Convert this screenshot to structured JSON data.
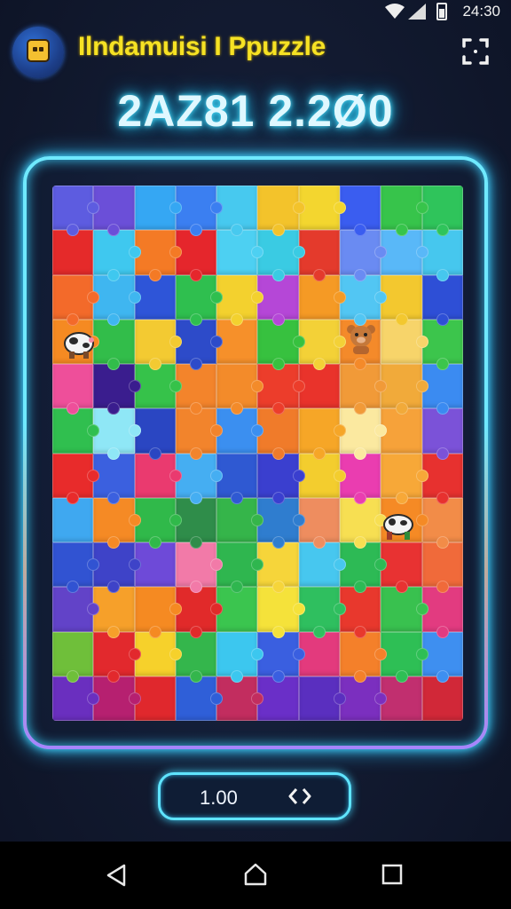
{
  "status_bar": {
    "time": "24:30",
    "icons": [
      "wifi-icon",
      "signal-icon",
      "battery-icon"
    ]
  },
  "header": {
    "title": "Ilndamuisi I Ppuzzle",
    "menu_icon": "fullscreen-corners-icon"
  },
  "score": {
    "text": "2AZ81 2.2Ø0"
  },
  "board": {
    "columns": 10,
    "rows": 12,
    "colors": [
      "#5d5ce0",
      "#6b4fd8",
      "#35a7f3",
      "#3b7ff1",
      "#47c9ef",
      "#f3c32b",
      "#f3d62f",
      "#3a5df0",
      "#37c44b",
      "#2fc45b",
      "#e52a2a",
      "#3fc8ef",
      "#f47a25",
      "#e5262c",
      "#4dd0f2",
      "#3acbe3",
      "#e43a2c",
      "#6a8bf2",
      "#59b8f8",
      "#46c7ee",
      "#f36a2a",
      "#3fb6f0",
      "#2e55d8",
      "#2fbf4f",
      "#f3d12e",
      "#b547d7",
      "#f59a25",
      "#52c6f3",
      "#f3c82f",
      "#2e4fd6",
      "#f58a22",
      "#32bd4a",
      "#f3ca32",
      "#2d4bc9",
      "#f6902a",
      "#37c13f",
      "#f3d137",
      "#f48a2a",
      "#f7d46a",
      "#3cc54c",
      "#ee4f9a",
      "#3a1d8e",
      "#36c24a",
      "#f3842b",
      "#f38b2a",
      "#ec3d2b",
      "#e9332b",
      "#f19a38",
      "#f1aa3a",
      "#3b8bf1",
      "#30bf4f",
      "#8fe7f6",
      "#2a46c2",
      "#f2842c",
      "#3b8ff0",
      "#f07b2a",
      "#f6a627",
      "#fbe9a0",
      "#f6a23a",
      "#7b52d8",
      "#e82b2b",
      "#3b60df",
      "#ea3a6f",
      "#45aef2",
      "#2f59d2",
      "#3a3fcf",
      "#f3cd2e",
      "#ea3db0",
      "#f7a838",
      "#e7312f",
      "#3fa8f0",
      "#f58a25",
      "#30b94a",
      "#2f8d4a",
      "#35b54a",
      "#2f7dcf",
      "#ee8d5f",
      "#f7df52",
      "#f58a25",
      "#f28c48",
      "#3153d2",
      "#3e43c8",
      "#6e4ad8",
      "#f27aa8",
      "#2fb64f",
      "#f6d53a",
      "#47c7ef",
      "#2dba55",
      "#e83232",
      "#f06a3a",
      "#6243c8",
      "#f6a02a",
      "#f58a22",
      "#e12a2a",
      "#3bc54f",
      "#f5e23a",
      "#2fbf5f",
      "#e8382d",
      "#39c14f",
      "#e23b80",
      "#6fbf3a",
      "#e2292d",
      "#f6d12b",
      "#34b64c",
      "#3cc7ef",
      "#3a5fe0",
      "#e33a7d",
      "#f4802a",
      "#2ebf55",
      "#3e8ff0",
      "#6a2fbf",
      "#b62070",
      "#e0282d",
      "#2f5fd8",
      "#c22d5f",
      "#6a2fc8",
      "#5a2fbf",
      "#7b2fbf",
      "#c12f6f",
      "#d12838"
    ],
    "characters": [
      {
        "name": "cow-character",
        "label": "cow"
      },
      {
        "name": "bear-character",
        "label": "bear"
      },
      {
        "name": "cow-character-2",
        "label": "cow"
      }
    ]
  },
  "zoom": {
    "value": "1.00",
    "toggle_icon": "double-arrow-icon"
  },
  "nav_bar": {
    "back": "back-triangle-icon",
    "home": "home-icon",
    "recent": "recent-apps-icon"
  }
}
